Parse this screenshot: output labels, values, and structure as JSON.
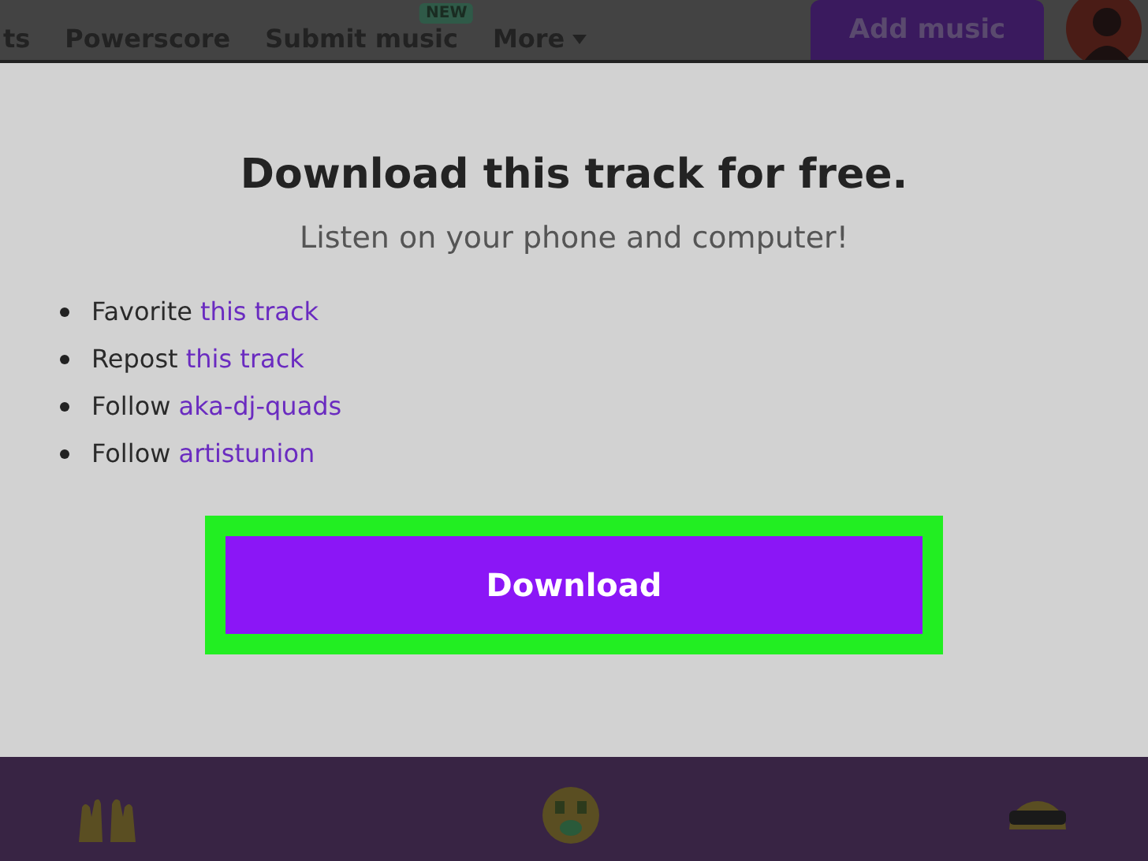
{
  "nav": {
    "items": [
      {
        "label": "ts",
        "dropdown": false
      },
      {
        "label": "Powerscore",
        "dropdown": false
      },
      {
        "label": "Submit music",
        "badge": "NEW",
        "dropdown": false
      },
      {
        "label": "More",
        "dropdown": true
      }
    ],
    "add_button": "Add music"
  },
  "dialog": {
    "title": "Download this track for free.",
    "subtitle": "Listen on your phone and computer!",
    "requirements": [
      {
        "text": "Favorite",
        "link": "this track"
      },
      {
        "text": "Repost",
        "link": "this track"
      },
      {
        "text": "Follow",
        "link": "aka-dj-quads"
      },
      {
        "text": "Follow",
        "link": "artistunion"
      }
    ],
    "button": {
      "label": "Download",
      "highlighted": true
    }
  }
}
